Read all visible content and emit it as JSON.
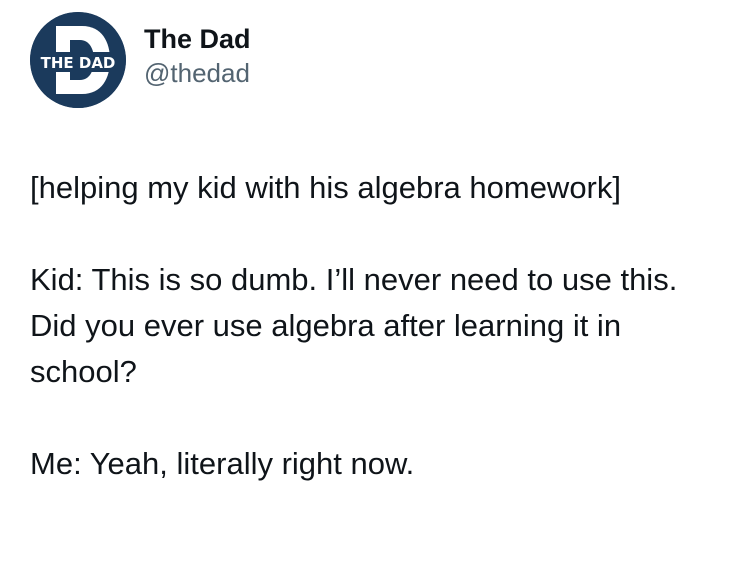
{
  "author": {
    "display_name": "The Dad",
    "handle": "@thedad",
    "avatar_text": "THE DAD",
    "avatar_letter": "D",
    "avatar_color": "#1b3a5c"
  },
  "post": {
    "paragraphs": [
      "[helping my kid with his algebra homework]",
      "Kid: This is so dumb. I’ll never need to use this. Did you ever use algebra after learning it in school?",
      "Me: Yeah, literally right now."
    ]
  }
}
